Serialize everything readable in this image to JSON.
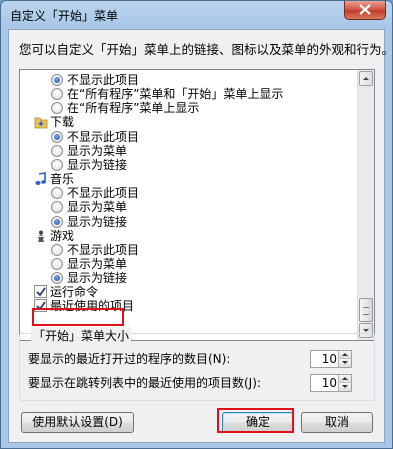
{
  "window": {
    "title": "自定义「开始」菜单"
  },
  "description": "您可以自定义「开始」菜单上的链接、图标以及菜单的外观和行为。",
  "list": [
    {
      "kind": "radio",
      "label": "不显示此项目",
      "checked": true
    },
    {
      "kind": "radio",
      "label": "在“所有程序”菜单和「开始」菜单上显示",
      "checked": false
    },
    {
      "kind": "radio",
      "label": "在“所有程序”菜单上显示",
      "checked": false
    },
    {
      "kind": "category",
      "label": "下载",
      "icon": "downloads-folder-icon"
    },
    {
      "kind": "radio",
      "label": "不显示此项目",
      "checked": true
    },
    {
      "kind": "radio",
      "label": "显示为菜单",
      "checked": false
    },
    {
      "kind": "radio",
      "label": "显示为链接",
      "checked": false
    },
    {
      "kind": "category",
      "label": "音乐",
      "icon": "music-note-icon"
    },
    {
      "kind": "radio",
      "label": "不显示此项目",
      "checked": false
    },
    {
      "kind": "radio",
      "label": "显示为菜单",
      "checked": false
    },
    {
      "kind": "radio",
      "label": "显示为链接",
      "checked": true
    },
    {
      "kind": "category",
      "label": "游戏",
      "icon": "games-chess-icon"
    },
    {
      "kind": "radio",
      "label": "不显示此项目",
      "checked": false
    },
    {
      "kind": "radio",
      "label": "显示为菜单",
      "checked": false
    },
    {
      "kind": "radio",
      "label": "显示为链接",
      "checked": true
    },
    {
      "kind": "checkbox",
      "label": "运行命令",
      "checked": true
    },
    {
      "kind": "checkbox",
      "label": "最近使用的项目",
      "checked": true
    }
  ],
  "start_menu_size": {
    "title": "「开始」菜单大小",
    "recent_programs_label": "要显示的最近打开过的程序的数目(N):",
    "recent_programs_value": "10",
    "jump_list_label": "要显示在跳转列表中的最近使用的项目数(J):",
    "jump_list_value": "10"
  },
  "buttons": {
    "defaults": "使用默认设置(D)",
    "ok": "确定",
    "cancel": "取消"
  },
  "colors": {
    "highlight": "#e0101a",
    "titlebar": "#a9c8e8"
  }
}
